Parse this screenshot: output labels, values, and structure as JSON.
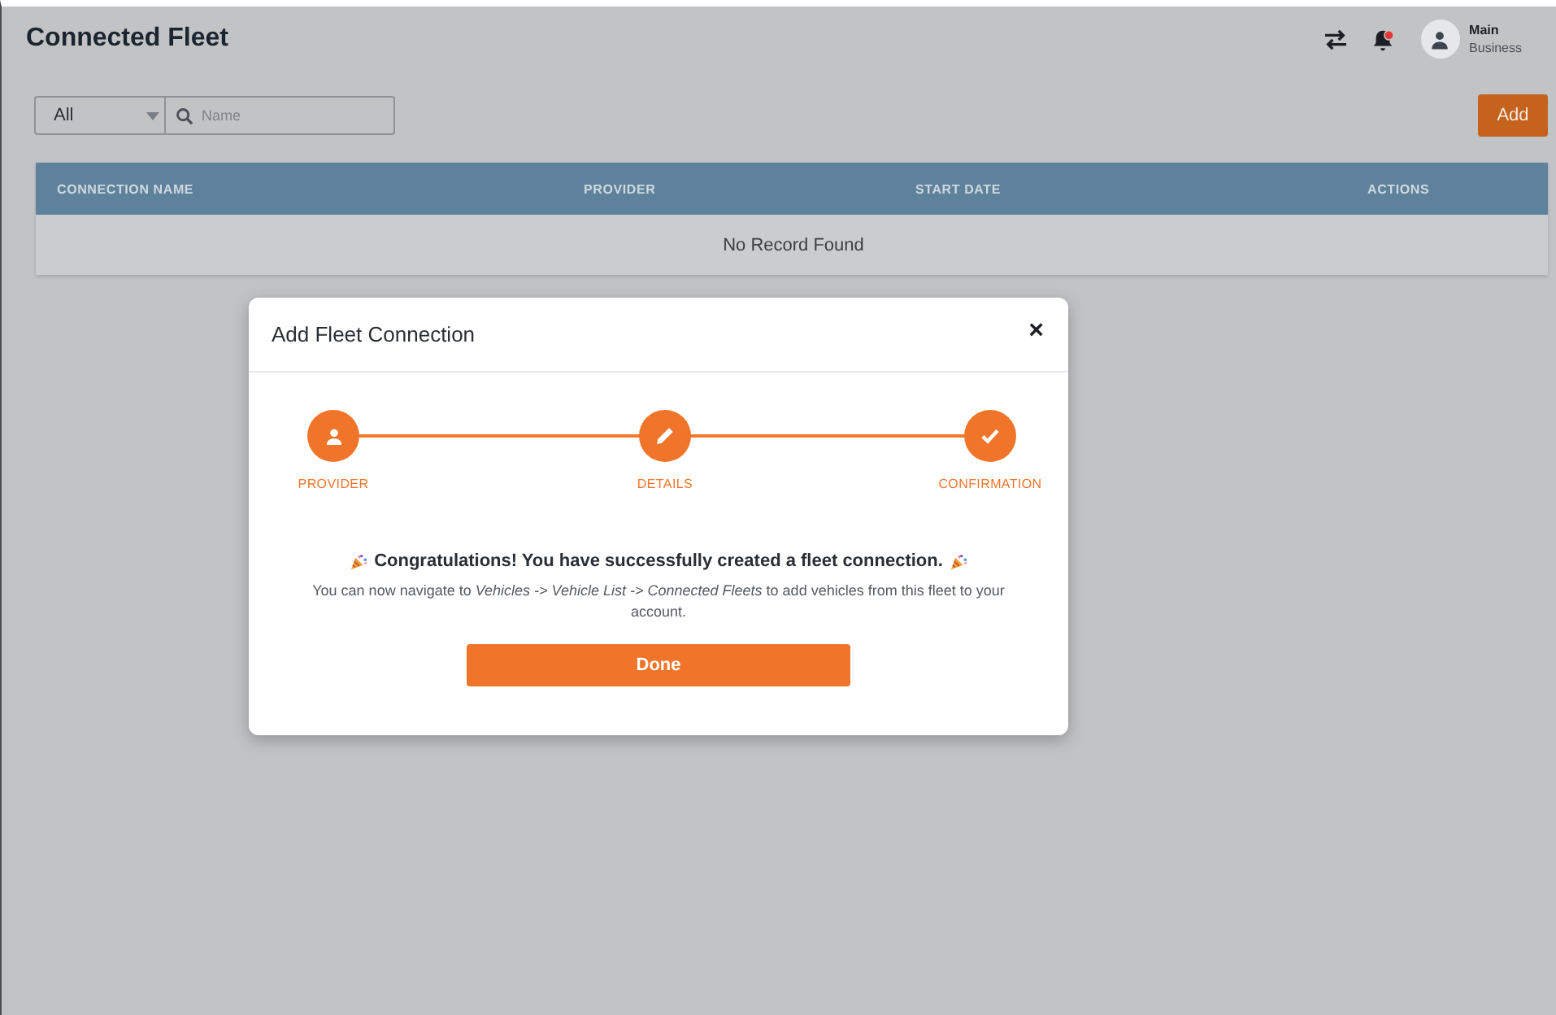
{
  "page": {
    "title": "Connected Fleet"
  },
  "header": {
    "bell_has_notification": true,
    "user_name": "Main",
    "user_role": "Business"
  },
  "filter": {
    "value": "All",
    "placeholder": "Name"
  },
  "add_button": "Add",
  "table": {
    "columns": [
      "CONNECTION NAME",
      "PROVIDER",
      "START DATE",
      "ACTIONS"
    ],
    "empty_text": "No Record Found"
  },
  "modal": {
    "title": "Add Fleet Connection",
    "close": "×",
    "steps": [
      {
        "label": "PROVIDER",
        "kind": "person",
        "completed": true
      },
      {
        "label": "DETAILS",
        "kind": "pencil",
        "completed": true
      },
      {
        "label": "CONFIRMATION",
        "kind": "check",
        "completed": true
      }
    ],
    "heading": "Congratulations! You have successfully created a fleet connection.",
    "message": "You can now navigate to *Vehicles -> Vehicle List -> Connected Fleets* to add vehicles from this fleet to your account.",
    "done_button": "Done"
  }
}
